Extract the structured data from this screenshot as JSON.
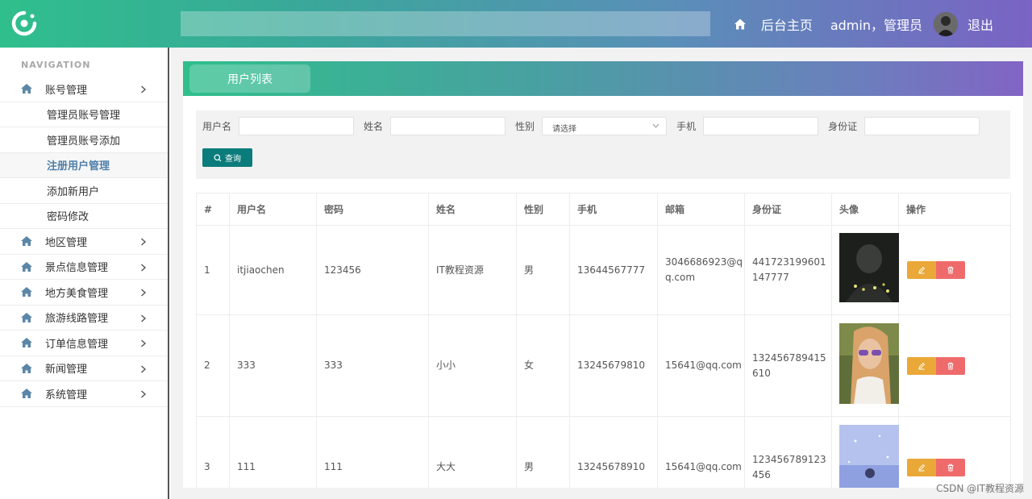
{
  "header": {
    "home_label": "后台主页",
    "user_label": "admin，管理员",
    "logout_label": "退出"
  },
  "sidebar": {
    "title": "NAVIGATION",
    "items": [
      {
        "label": "账号管理",
        "children": [
          "管理员账号管理",
          "管理员账号添加",
          "注册用户管理",
          "添加新用户",
          "密码修改"
        ],
        "active_child": "注册用户管理"
      },
      {
        "label": "地区管理"
      },
      {
        "label": "景点信息管理"
      },
      {
        "label": "地方美食管理"
      },
      {
        "label": "旅游线路管理"
      },
      {
        "label": "订单信息管理"
      },
      {
        "label": "新闻管理"
      },
      {
        "label": "系统管理"
      }
    ]
  },
  "panel": {
    "tab_label": "用户列表"
  },
  "filter": {
    "username_label": "用户名",
    "name_label": "姓名",
    "gender_label": "性别",
    "gender_placeholder": "请选择",
    "phone_label": "手机",
    "idcard_label": "身份证",
    "search_label": "查询"
  },
  "table": {
    "columns": [
      "#",
      "用户名",
      "密码",
      "姓名",
      "性别",
      "手机",
      "邮箱",
      "身份证",
      "头像",
      "操作"
    ],
    "rows": [
      {
        "no": "1",
        "username": "itjiaochen",
        "password": "123456",
        "name": "IT教程资源",
        "gender": "男",
        "phone": "13644567777",
        "email": "3046686923@qq.com",
        "idcard": "441723199601147777"
      },
      {
        "no": "2",
        "username": "333",
        "password": "333",
        "name": "小小",
        "gender": "女",
        "phone": "13245679810",
        "email": "15641@qq.com",
        "idcard": "132456789415610"
      },
      {
        "no": "3",
        "username": "111",
        "password": "111",
        "name": "大大",
        "gender": "男",
        "phone": "13245678910",
        "email": "15641@qq.com",
        "idcard": "123456789123456"
      }
    ]
  },
  "watermark": "CSDN @IT教程资源",
  "colors": {
    "accent_teal": "#0b7c7c",
    "edit_orange": "#e9a838",
    "delete_red": "#ef6b6b",
    "active_text": "#4f7fa8"
  }
}
